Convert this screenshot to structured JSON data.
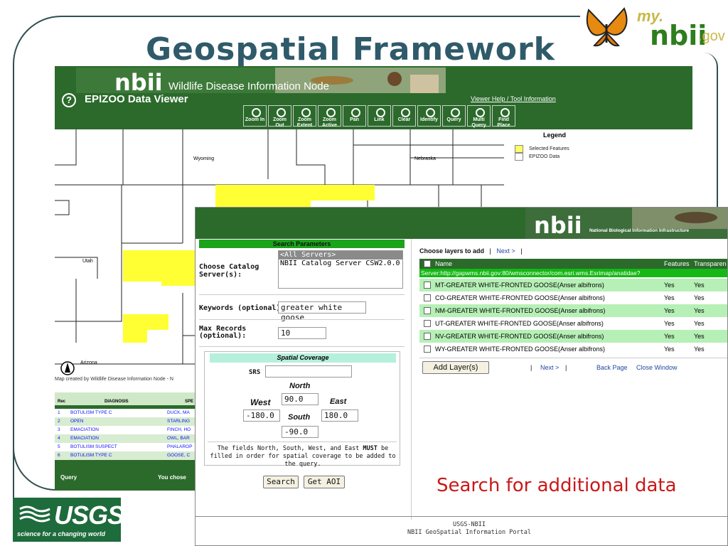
{
  "slide": {
    "title": "Geospatial Framework",
    "caption": "Search for additional data",
    "logo": {
      "my": "my.",
      "nbii": "nbii",
      "gov": ".gov"
    },
    "usgs": {
      "name": "USGS",
      "tagline": "science for a changing world"
    }
  },
  "epizoo": {
    "banner_text": "Wildlife Disease Information Node",
    "nbii_text": "nbii",
    "help_icon": "?",
    "title": "EPIZOO Data Viewer",
    "help_link": "Viewer Help / Tool Information",
    "tools": [
      {
        "icon": "zoom-in-icon",
        "label": "Zoom In"
      },
      {
        "icon": "zoom-out-icon",
        "label": "Zoom Out"
      },
      {
        "icon": "zoom-extent-icon",
        "label": "Zoom Extent"
      },
      {
        "icon": "zoom-active-icon",
        "label": "Zoom Active"
      },
      {
        "icon": "pan-icon",
        "label": "Pan"
      },
      {
        "icon": "link-icon",
        "label": "Link"
      },
      {
        "icon": "clear-icon",
        "label": "Clear"
      },
      {
        "icon": "identify-icon",
        "label": "Identify"
      },
      {
        "icon": "query-icon",
        "label": "Query"
      },
      {
        "icon": "multi-query-icon",
        "label": "Multi Query"
      },
      {
        "icon": "find-place-icon",
        "label": "Find Place"
      }
    ],
    "map_labels": {
      "wyoming": "Wyoming",
      "nebraska": "Nebraska",
      "utah": "Utah",
      "arizona": "Arizona"
    },
    "legend": {
      "title": "Legend",
      "items": [
        {
          "label": "Selected Features",
          "color": "#ffff66"
        },
        {
          "label": "EPIZOO Data",
          "color": "#ffffff"
        }
      ]
    },
    "map_credit": "Map created by Wildlife Disease Information Node - N",
    "table": {
      "columns": [
        "Rec",
        "DIAGNOSIS",
        "SPE"
      ],
      "rows": [
        {
          "rec": "1",
          "diagnosis": "BOTULISM TYPE C",
          "species": "DUCK, MA"
        },
        {
          "rec": "2",
          "diagnosis": "OPEN",
          "species": "STARLING"
        },
        {
          "rec": "3",
          "diagnosis": "EMACIATION",
          "species": "FINCH, HO"
        },
        {
          "rec": "4",
          "diagnosis": "EMACIATION",
          "species": "OWL, BAR"
        },
        {
          "rec": "5",
          "diagnosis": "BOTULISM SUSPECT",
          "species": "PHALAROP"
        },
        {
          "rec": "6",
          "diagnosis": "BOTULISM TYPE C",
          "species": "GOOSE, C"
        }
      ],
      "footer_left": "Query",
      "footer_right": "You chose"
    }
  },
  "portal": {
    "logo_big": "nbii",
    "logo_small": "National Biological Information Infrastructure",
    "search": {
      "header": "Search Parameters",
      "catalog_label": "Choose Catalog Server(s):",
      "catalog_options": [
        "<All Servers>",
        "NBII Catalog Server CSW2.0.0"
      ],
      "keywords_label": "Keywords (optional):",
      "keywords_value": "greater white goose",
      "max_label": "Max Records (optional):",
      "max_value": "10",
      "spatial": {
        "header": "Spatial Coverage",
        "srs_label": "SRS",
        "srs_value": "",
        "north_label": "North",
        "north_value": "90.0",
        "west_label": "West",
        "west_value": "-180.0",
        "east_label": "East",
        "east_value": "180.0",
        "south_label": "South",
        "south_value": "-90.0",
        "note_pre": "The fields North, South, West, and East ",
        "note_must": "MUST",
        "note_post": " be filled in order for spatial coverage to be added to the query."
      },
      "search_button": "Search",
      "aoi_button": "Get AOI"
    },
    "layers": {
      "choose_label": "Choose layers to add",
      "sep": "|",
      "next": "Next >",
      "header_name": "Name",
      "header_features": "Features",
      "header_transparent": "Transparen",
      "server": "Server:http://gapwms.nbii.gov:80/wmsconnector/com.esri.wms.Esrimap/anatidae?",
      "rows": [
        {
          "name": "MT-GREATER WHITE-FRONTED GOOSE(Anser albifrons)",
          "features": "Yes",
          "transparent": "Yes"
        },
        {
          "name": "CO-GREATER WHITE-FRONTED GOOSE(Anser albifrons)",
          "features": "Yes",
          "transparent": "Yes"
        },
        {
          "name": "NM-GREATER WHITE-FRONTED GOOSE(Anser albifrons)",
          "features": "Yes",
          "transparent": "Yes"
        },
        {
          "name": "UT-GREATER WHITE-FRONTED GOOSE(Anser albifrons)",
          "features": "Yes",
          "transparent": "Yes"
        },
        {
          "name": "NV-GREATER WHITE-FRONTED GOOSE(Anser albifrons)",
          "features": "Yes",
          "transparent": "Yes"
        },
        {
          "name": "WY-GREATER WHITE-FRONTED GOOSE(Anser albifrons)",
          "features": "Yes",
          "transparent": "Yes"
        }
      ],
      "add_button": "Add Layer(s)",
      "next_bottom": "Next >",
      "back": "Back Page",
      "close": "Close Window"
    },
    "footer_line1": "USGS-NBII",
    "footer_line2": "NBII GeoSpatial Information Portal"
  }
}
